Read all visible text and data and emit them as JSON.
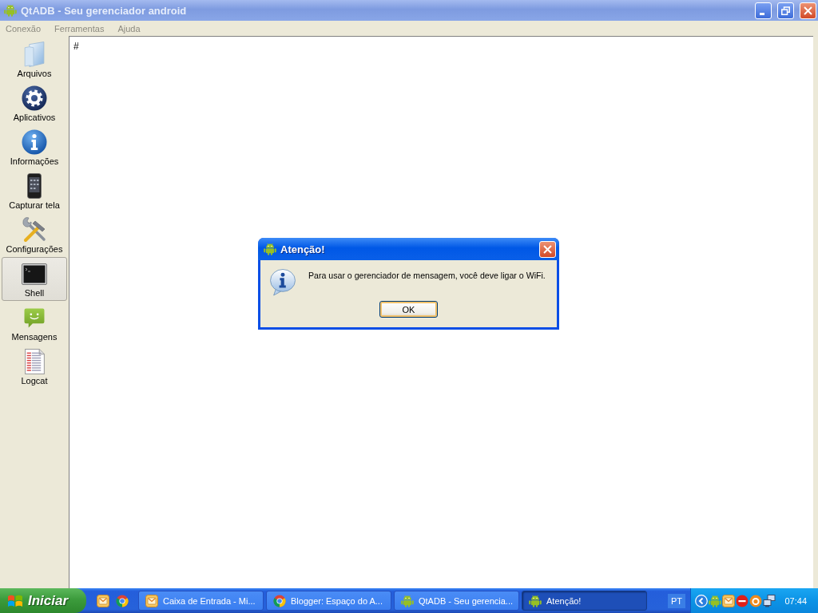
{
  "window": {
    "title": "QtADB - Seu gerenciador android",
    "active": false
  },
  "menu_bar": [
    {
      "label": "Conexão",
      "disabled": true
    },
    {
      "label": "Ferramentas",
      "disabled": true
    },
    {
      "label": "Ajuda",
      "disabled": true
    }
  ],
  "sidebar": {
    "items": [
      {
        "label": "Arquivos",
        "selected": false
      },
      {
        "label": "Aplicativos",
        "selected": false
      },
      {
        "label": "Informações",
        "selected": false
      },
      {
        "label": "Capturar tela",
        "selected": false
      },
      {
        "label": "Configurações",
        "selected": false
      },
      {
        "label": "Shell",
        "selected": true
      },
      {
        "label": "Mensagens",
        "selected": false
      },
      {
        "label": "Logcat",
        "selected": false
      }
    ]
  },
  "shell": {
    "prompt": "#"
  },
  "dialog": {
    "title": "Atenção!",
    "message": "Para usar o gerenciador de mensagem, você deve ligar o WiFi.",
    "buttons": [
      "OK"
    ]
  },
  "taskbar": {
    "start_label": "Iniciar",
    "tasks": [
      {
        "label": "Caixa de Entrada - Mi...",
        "selected": false
      },
      {
        "label": "Blogger: Espaço do A...",
        "selected": false
      },
      {
        "label": "QtADB - Seu gerencia...",
        "selected": false
      },
      {
        "label": "Atenção!",
        "selected": true
      }
    ],
    "language": "PT",
    "clock": "07:44"
  }
}
